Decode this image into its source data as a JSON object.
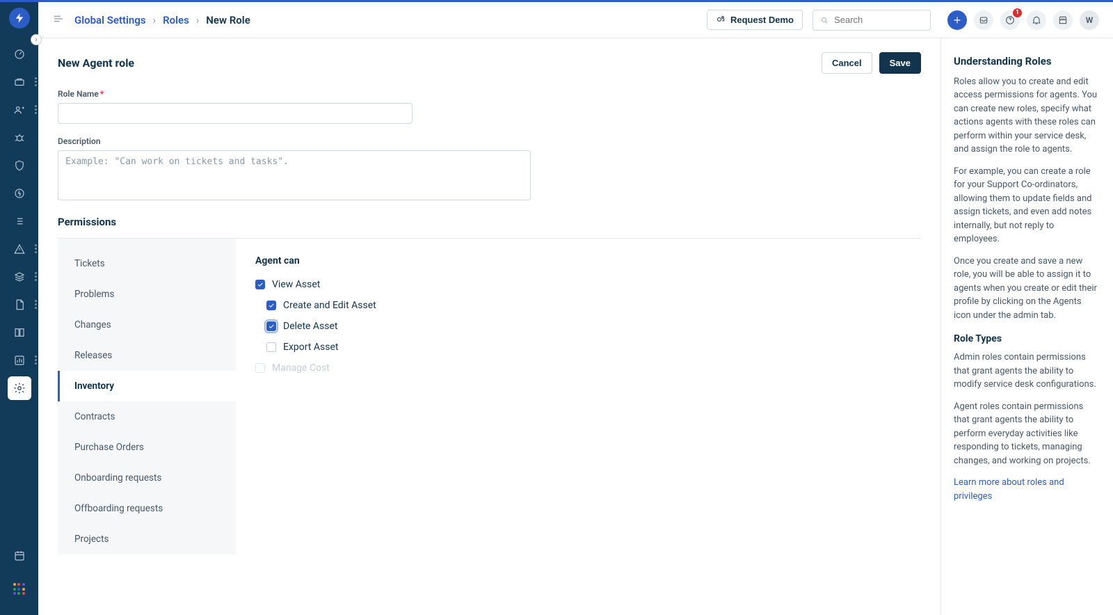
{
  "breadcrumbs": {
    "level1": "Global Settings",
    "level2": "Roles",
    "current": "New Role"
  },
  "topbar": {
    "request_demo": "Request Demo",
    "search_placeholder": "Search",
    "notification_badge": "1",
    "avatar_initial": "W"
  },
  "page": {
    "title": "New Agent role",
    "cancel": "Cancel",
    "save": "Save"
  },
  "form": {
    "role_name_label": "Role Name",
    "role_name_value": "",
    "description_label": "Description",
    "description_placeholder": "Example: \"Can work on tickets and tasks\"."
  },
  "permissions": {
    "title": "Permissions",
    "tabs": [
      "Tickets",
      "Problems",
      "Changes",
      "Releases",
      "Inventory",
      "Contracts",
      "Purchase Orders",
      "Onboarding requests",
      "Offboarding requests",
      "Projects"
    ],
    "active_tab_index": 4,
    "body_heading": "Agent can",
    "items": [
      {
        "label": "View Asset",
        "checked": true,
        "child": false,
        "disabled": false,
        "focused": false
      },
      {
        "label": "Create and Edit Asset",
        "checked": true,
        "child": true,
        "disabled": false,
        "focused": false
      },
      {
        "label": "Delete Asset",
        "checked": true,
        "child": true,
        "disabled": false,
        "focused": true
      },
      {
        "label": "Export Asset",
        "checked": false,
        "child": true,
        "disabled": false,
        "focused": false
      },
      {
        "label": "Manage Cost",
        "checked": false,
        "child": false,
        "disabled": true,
        "focused": false
      }
    ]
  },
  "help": {
    "h1": "Understanding Roles",
    "p1": "Roles allow you to create and edit access permissions for agents. You can create new roles, specify what actions agents with these roles can perform within your service desk, and assign the role to agents.",
    "p2": "For example, you can create a role for your Support Co-ordinators, allowing them to update fields and assign tickets, and even add notes internally, but not reply to employees.",
    "p3": "Once you create and save a new role, you will be able to assign it to agents when you create or edit their profile by clicking on the Agents icon under the admin tab.",
    "h2": "Role Types",
    "p4": "Admin roles contain permissions that grant agents the ability to modify service desk configurations.",
    "p5": "Agent roles contain permissions that grant agents the ability to perform everyday activities like responding to tickets, managing changes, and working on projects.",
    "link": "Learn more about roles and privileges"
  }
}
